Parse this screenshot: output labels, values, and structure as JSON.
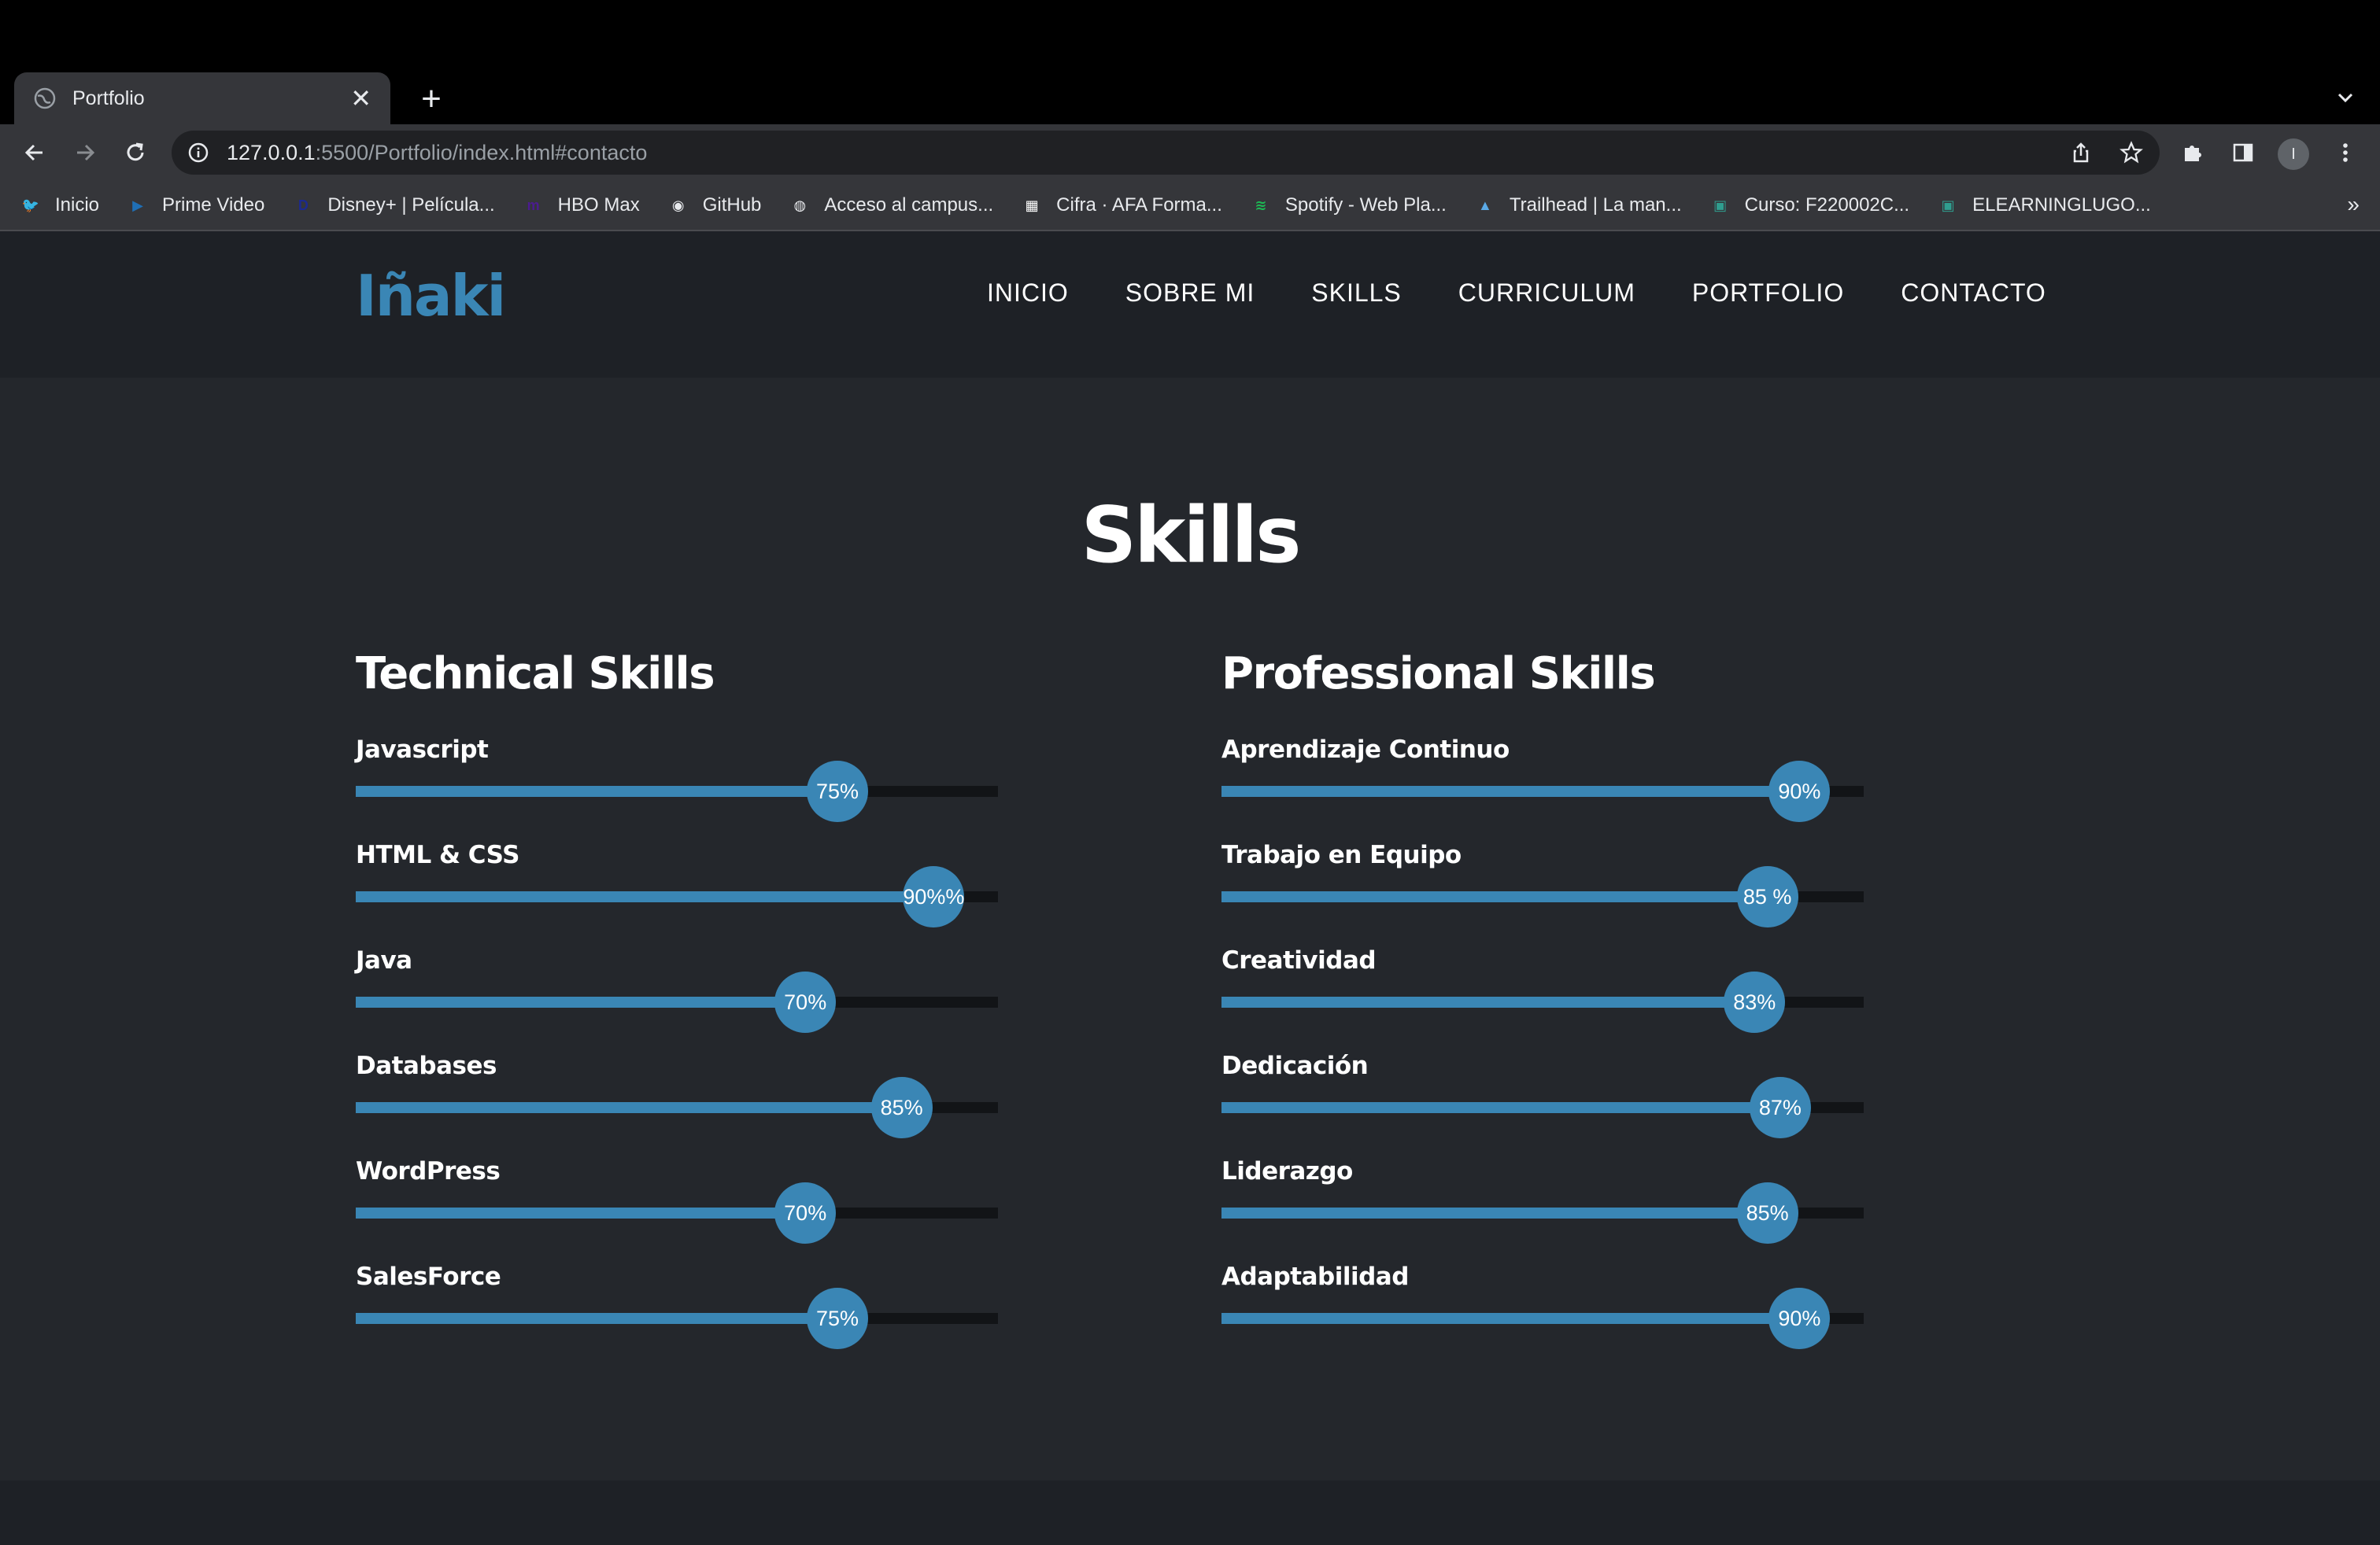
{
  "browser": {
    "tab_title": "Portfolio",
    "tab_close": "✕",
    "new_tab": "+",
    "url_host": "127.0.0.1",
    "url_rest": ":5500/Portfolio/index.html#contacto",
    "profile_initial": "I",
    "bookmarks_more": "»",
    "bookmarks": [
      {
        "label": "Inicio",
        "icon": "twitter-icon",
        "color": "#1d9bf0",
        "glyph": "🐦"
      },
      {
        "label": "Prime Video",
        "icon": "prime-video-icon",
        "color": "#1f6fb5",
        "glyph": "▶"
      },
      {
        "label": "Disney+ | Película...",
        "icon": "disney-icon",
        "color": "#1c2a8f",
        "glyph": "D"
      },
      {
        "label": "HBO Max",
        "icon": "hbo-icon",
        "color": "#4b1c8f",
        "glyph": "m"
      },
      {
        "label": "GitHub",
        "icon": "github-icon",
        "color": "#e8eaed",
        "glyph": "◉"
      },
      {
        "label": "Acceso al campus...",
        "icon": "globe-icon",
        "color": "#e8eaed",
        "glyph": "◍"
      },
      {
        "label": "Cifra · AFA Forma...",
        "icon": "cifra-icon",
        "color": "#ffffff",
        "glyph": "▦"
      },
      {
        "label": "Spotify - Web Pla...",
        "icon": "spotify-icon",
        "color": "#1db954",
        "glyph": "≋"
      },
      {
        "label": "Trailhead | La man...",
        "icon": "trailhead-icon",
        "color": "#5aa9e6",
        "glyph": "▲"
      },
      {
        "label": "Curso: F220002C...",
        "icon": "course-icon",
        "color": "#2f9e8f",
        "glyph": "▣"
      },
      {
        "label": "ELEARNINGLUGO...",
        "icon": "elearning-icon",
        "color": "#2f9e8f",
        "glyph": "▣"
      }
    ]
  },
  "site": {
    "logo": "Iñaki",
    "nav": [
      "INICIO",
      "SOBRE MI",
      "SKILLS",
      "CURRICULUM",
      "PORTFOLIO",
      "CONTACTO"
    ]
  },
  "skills": {
    "title": "Skills",
    "technical": {
      "heading": "Technical Skills",
      "items": [
        {
          "name": "Javascript",
          "label": "75%",
          "level": 0.75
        },
        {
          "name": "HTML & CSS",
          "label": "90%%",
          "level": 0.9
        },
        {
          "name": "Java",
          "label": "70%",
          "level": 0.7
        },
        {
          "name": "Databases",
          "label": "85%",
          "level": 0.85
        },
        {
          "name": "WordPress",
          "label": "70%",
          "level": 0.7
        },
        {
          "name": "SalesForce",
          "label": "75%",
          "level": 0.75
        }
      ]
    },
    "professional": {
      "heading": "Professional Skills",
      "items": [
        {
          "name": "Aprendizaje Continuo",
          "label": "90%",
          "level": 0.9
        },
        {
          "name": "Trabajo en Equipo",
          "label": "85 %",
          "level": 0.85
        },
        {
          "name": "Creatividad",
          "label": "83%",
          "level": 0.83
        },
        {
          "name": "Dedicación",
          "label": "87%",
          "level": 0.87
        },
        {
          "name": "Liderazgo",
          "label": "85%",
          "level": 0.85
        },
        {
          "name": "Adaptabilidad",
          "label": "90%",
          "level": 0.9
        }
      ]
    }
  },
  "colors": {
    "accent": "#3a86b5",
    "page_bg": "#24272c",
    "header_bg": "#1e2126",
    "track": "#121417"
  }
}
